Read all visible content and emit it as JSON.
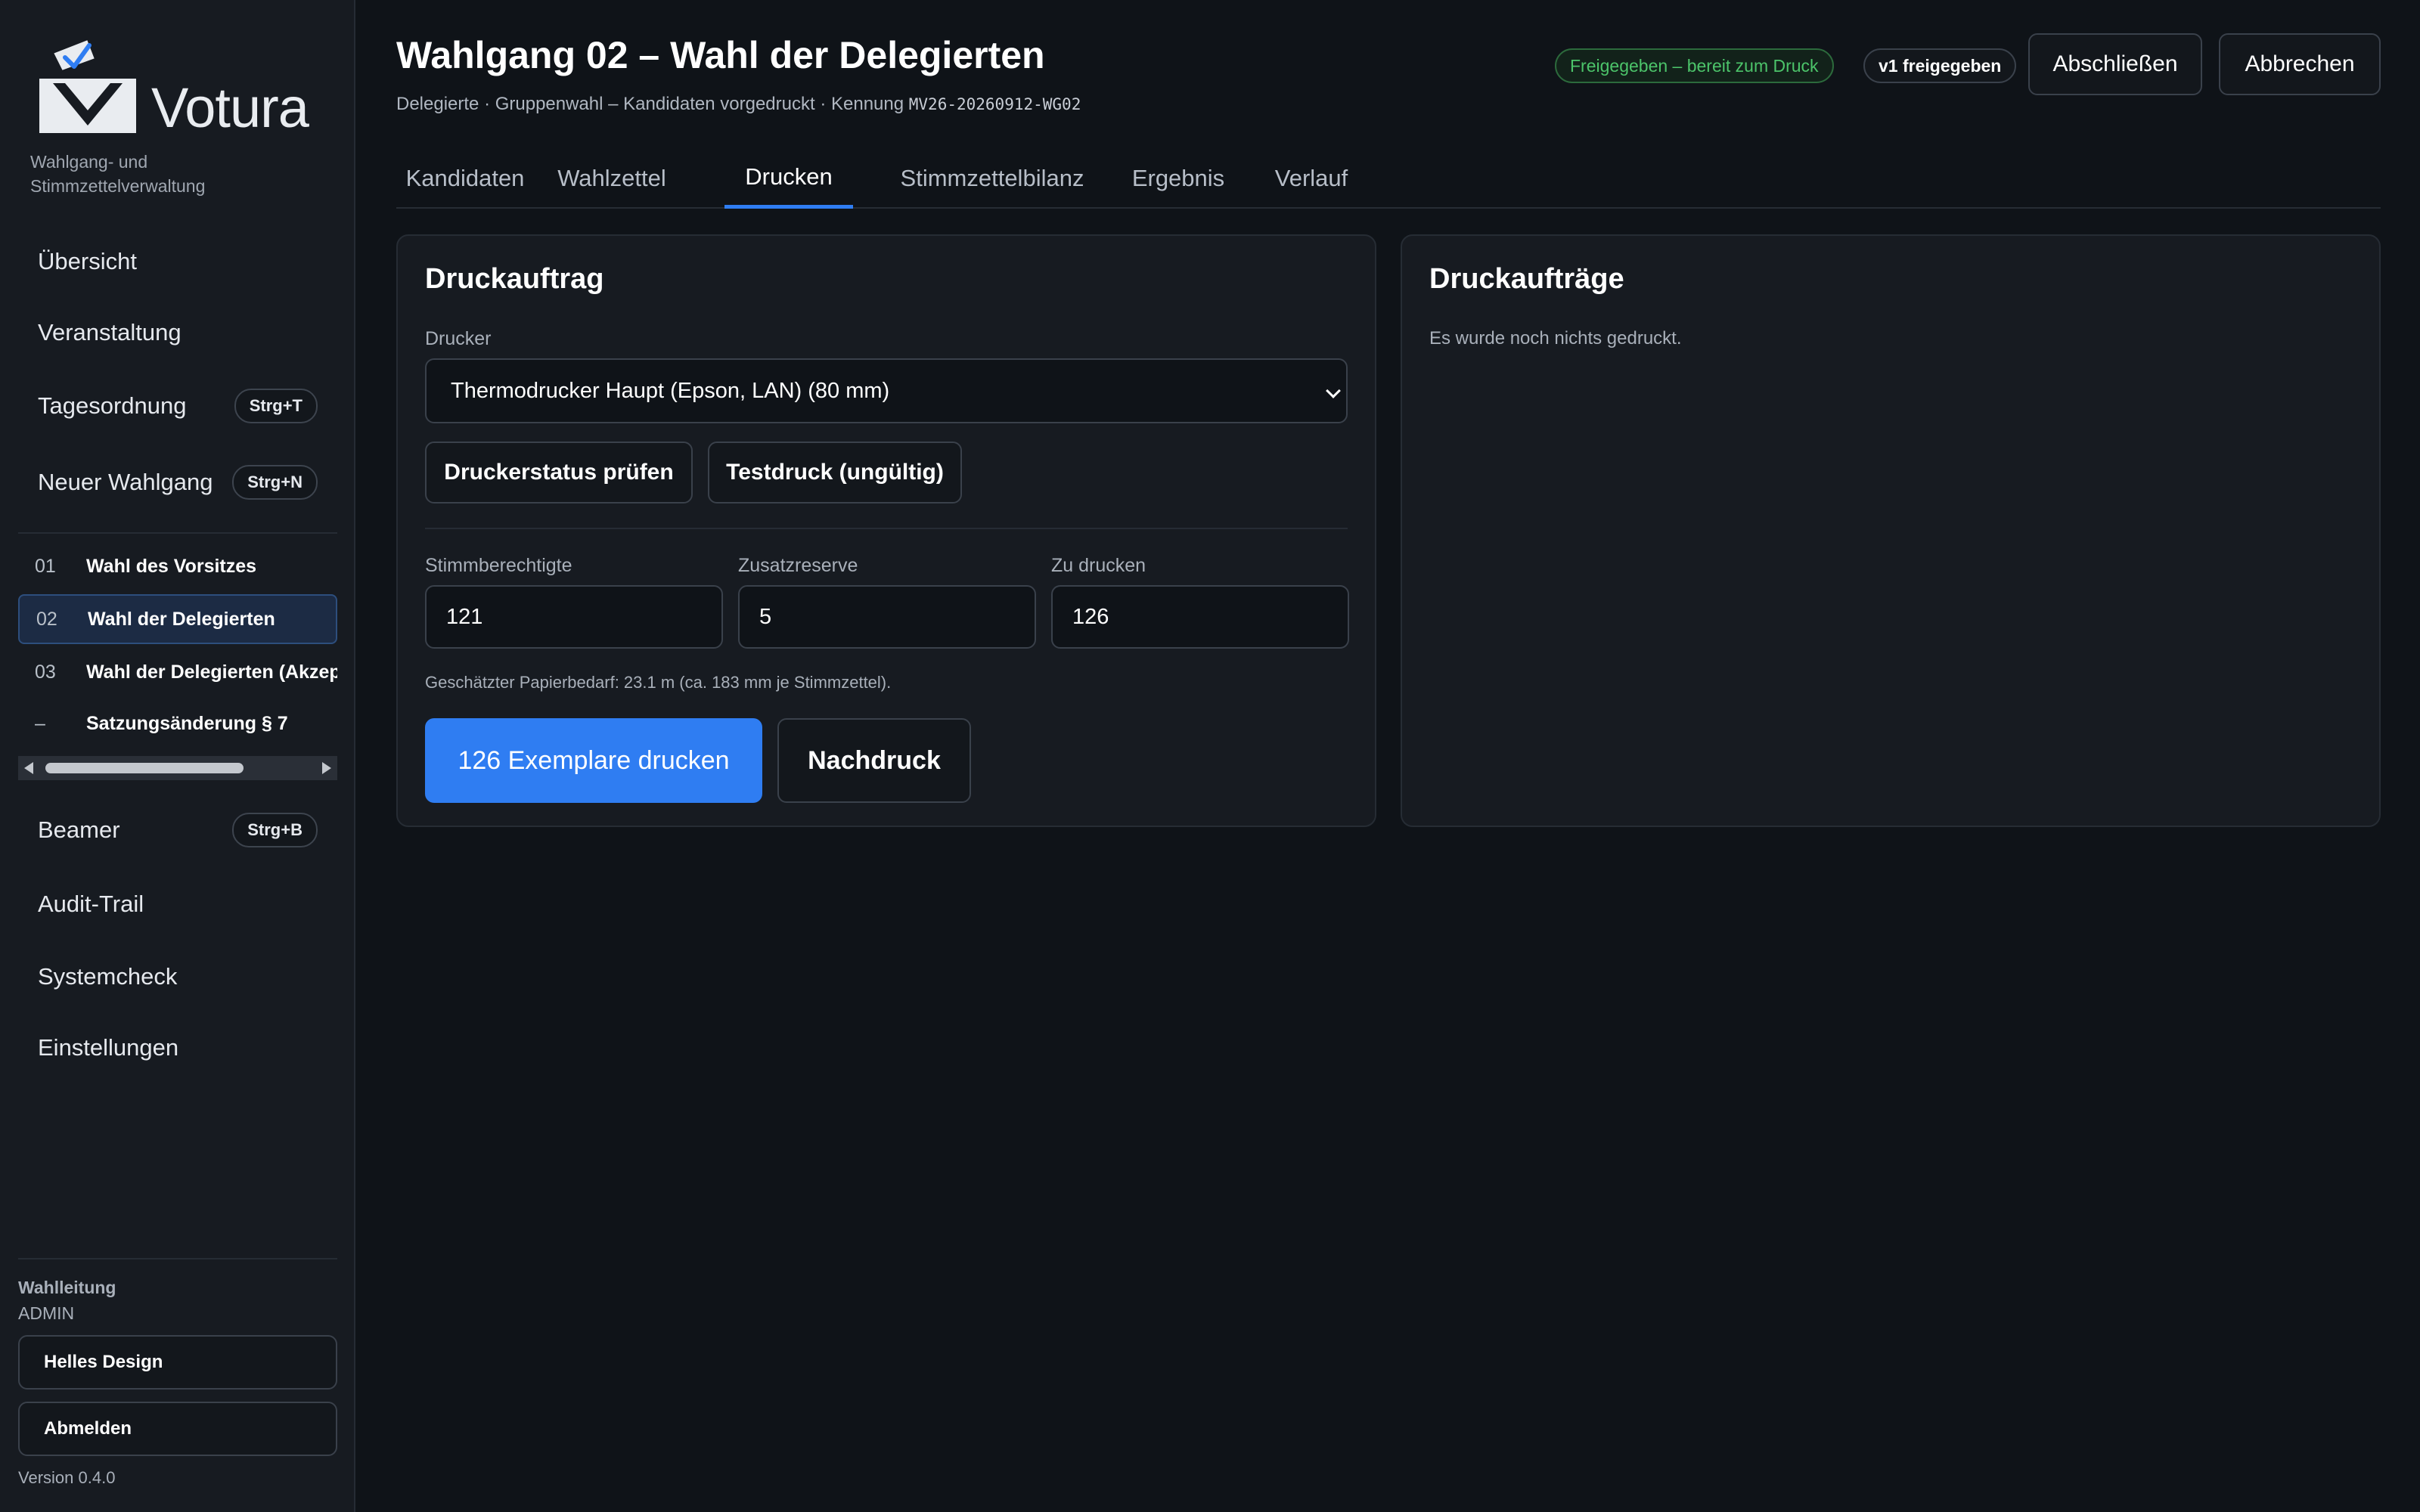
{
  "brand": {
    "name": "Votura",
    "subtitle": "Wahlgang- und Stimmzettelverwaltung"
  },
  "sidebar": {
    "nav_top": [
      {
        "label": "Übersicht"
      },
      {
        "label": "Veranstaltung"
      },
      {
        "label": "Tagesordnung",
        "shortcut": "Strg+T"
      },
      {
        "label": "Neuer Wahlgang",
        "shortcut": "Strg+N"
      }
    ],
    "ballots": [
      {
        "num": "01",
        "label": "Wahl des Vorsitzes"
      },
      {
        "num": "02",
        "label": "Wahl der Delegierten",
        "active": true
      },
      {
        "num": "03",
        "label": "Wahl der Delegierten (Akzeptanz)"
      },
      {
        "num": "–",
        "label": "Satzungsänderung § 7"
      }
    ],
    "nav_bottom": [
      {
        "label": "Beamer",
        "shortcut": "Strg+B"
      },
      {
        "label": "Audit-Trail"
      },
      {
        "label": "Systemcheck"
      },
      {
        "label": "Einstellungen"
      }
    ],
    "user": {
      "role": "Wahlleitung",
      "name": "ADMIN"
    },
    "theme_button": "Helles Design",
    "logout_button": "Abmelden",
    "version": "Version 0.4.0"
  },
  "header": {
    "title": "Wahlgang 02 – Wahl der Delegierten",
    "meta": "Delegierte · Gruppenwahl – Kandidaten vorgedruckt · Kennung",
    "code": "MV26-20260912-WG02",
    "status_badge": "Freigegeben – bereit zum Druck",
    "version_badge": "v1 freigegeben",
    "close_button": "Abschließen",
    "cancel_button": "Abbrechen"
  },
  "tabs": [
    {
      "label": "Kandidaten"
    },
    {
      "label": "Wahlzettel"
    },
    {
      "label": "Drucken",
      "active": true
    },
    {
      "label": "Stimmzettelbilanz"
    },
    {
      "label": "Ergebnis"
    },
    {
      "label": "Verlauf"
    }
  ],
  "print_job": {
    "title": "Druckauftrag",
    "printer_label": "Drucker",
    "printer_value": "Thermodrucker Haupt (Epson, LAN) (80 mm)",
    "check_status_button": "Druckerstatus prüfen",
    "test_print_button": "Testdruck (ungültig)",
    "eligible_label": "Stimmberechtigte",
    "eligible_value": "121",
    "reserve_label": "Zusatzreserve",
    "reserve_value": "5",
    "to_print_label": "Zu drucken",
    "to_print_value": "126",
    "paper_hint": "Geschätzter Papierbedarf: 23.1 m (ca. 183 mm je Stimmzettel).",
    "print_button": "126 Exemplare drucken",
    "reprint_button": "Nachdruck"
  },
  "print_jobs": {
    "title": "Druckaufträge",
    "empty": "Es wurde noch nichts gedruckt."
  },
  "colors": {
    "accent": "#2f7df2",
    "success": "#4cc46a",
    "background": "#0f1318",
    "panel": "#171b21"
  }
}
